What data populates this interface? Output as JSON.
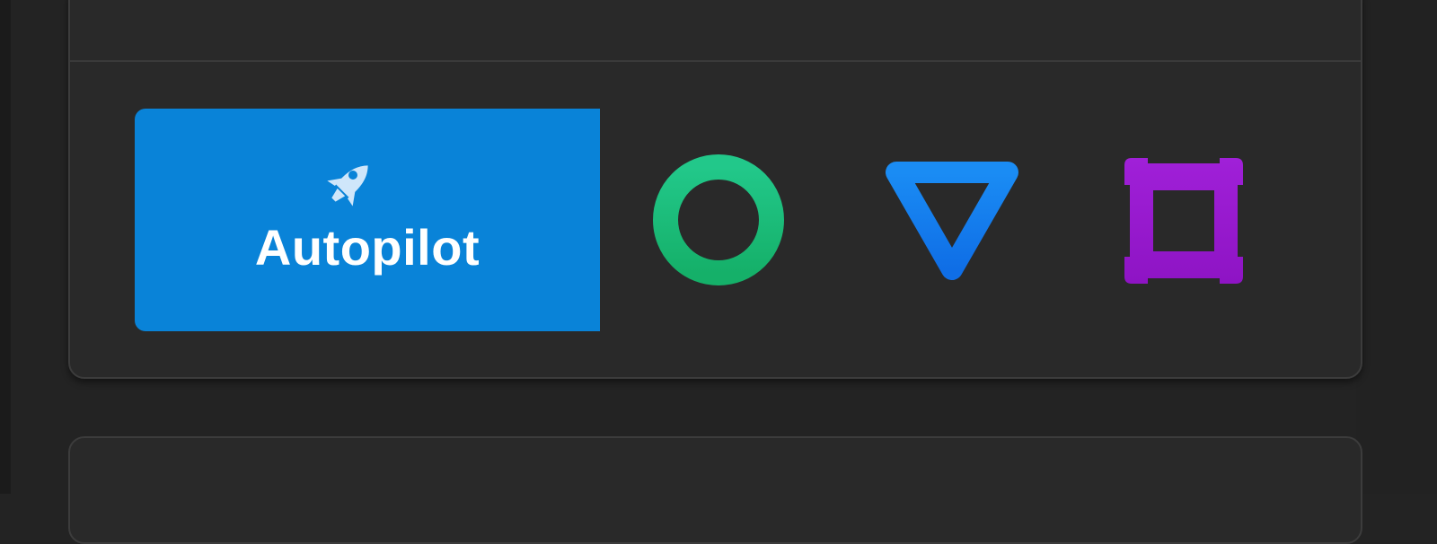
{
  "autopilot": {
    "label": "Autopilot",
    "icon": "rocket-icon",
    "color": "#0983d8"
  },
  "mode_buttons": [
    {
      "icon": "circle-icon",
      "color": "#1fbf7a"
    },
    {
      "icon": "triangle-icon",
      "color": "#1479ee"
    },
    {
      "icon": "square-icon",
      "color": "#9a1bd0"
    }
  ]
}
